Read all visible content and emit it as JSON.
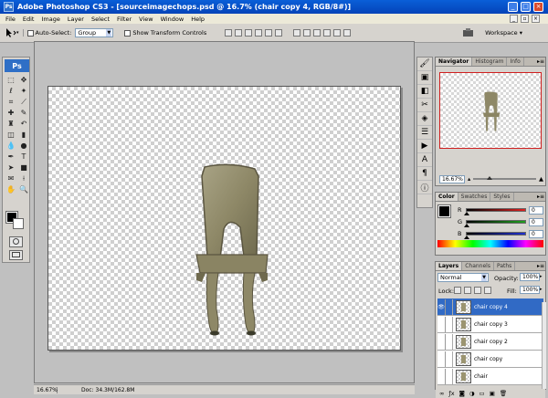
{
  "window": {
    "title": "Adobe Photoshop CS3 - [sourceimagechops.psd @ 16.7% (chair copy 4, RGB/8#)]",
    "logo": "Ps",
    "controls": {
      "minimize": "_",
      "maximize": "□",
      "close": "×"
    },
    "doc_controls": {
      "minimize": "_",
      "restore": "▫",
      "close": "×"
    }
  },
  "menu": [
    "File",
    "Edit",
    "Image",
    "Layer",
    "Select",
    "Filter",
    "View",
    "Window",
    "Help"
  ],
  "options": {
    "auto_select_label": "Auto-Select:",
    "auto_select_value": "Group",
    "show_transform_label": "Show Transform Controls",
    "workspace_label": "Workspace ▾"
  },
  "toolbox": {
    "title": "Ps"
  },
  "status": {
    "zoom": "16.67%",
    "doc": "Doc: 34.3M/162.8M"
  },
  "navigator": {
    "tabs": [
      "Navigator",
      "Histogram",
      "Info"
    ],
    "zoom_value": "16.67%"
  },
  "color_panel": {
    "tabs": [
      "Color",
      "Swatches",
      "Styles"
    ],
    "channels": [
      {
        "label": "R",
        "value": 0,
        "color": "#e02020"
      },
      {
        "label": "G",
        "value": 0,
        "color": "#20a020"
      },
      {
        "label": "B",
        "value": 0,
        "color": "#2030d0"
      }
    ]
  },
  "layers_panel": {
    "tabs": [
      "Layers",
      "Channels",
      "Paths"
    ],
    "blend_mode": "Normal",
    "opacity_label": "Opacity:",
    "opacity_value": "100%",
    "lock_label": "Lock:",
    "fill_label": "Fill:",
    "fill_value": "100%",
    "layers": [
      {
        "name": "chair copy 4",
        "visible": true,
        "selected": true
      },
      {
        "name": "chair copy 3",
        "visible": false,
        "selected": false
      },
      {
        "name": "chair copy 2",
        "visible": false,
        "selected": false
      },
      {
        "name": "chair copy",
        "visible": false,
        "selected": false
      },
      {
        "name": "chair",
        "visible": false,
        "selected": false
      }
    ]
  },
  "colors": {
    "title_bar": "#0443b8",
    "selection": "#316ac5",
    "navigator_frame": "#d02020"
  }
}
